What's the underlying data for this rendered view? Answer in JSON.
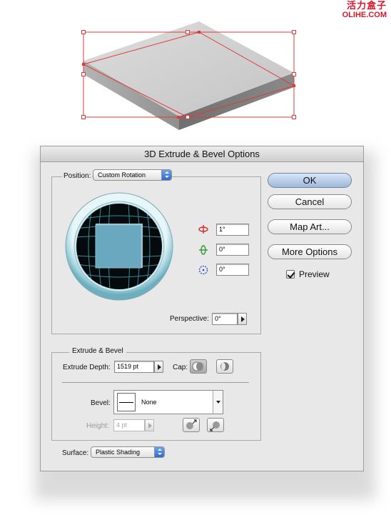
{
  "watermark": {
    "chinese": "活力盒子",
    "latin": "OLIHE.COM"
  },
  "dialog": {
    "title": "3D Extrude & Bevel Options",
    "position": {
      "label": "Position:",
      "value": "Custom Rotation"
    },
    "rotation": {
      "x": "1°",
      "y": "0°",
      "z": "0°"
    },
    "perspective": {
      "label": "Perspective:",
      "value": "0°"
    },
    "extrude_group": {
      "title": "Extrude & Bevel"
    },
    "extrude_depth": {
      "label": "Extrude Depth:",
      "value": "1519 pt"
    },
    "cap": {
      "label": "Cap:"
    },
    "bevel": {
      "label": "Bevel:",
      "value": "None"
    },
    "height": {
      "label": "Height:",
      "value": "4 pt"
    },
    "surface": {
      "label": "Surface:",
      "value": "Plastic Shading"
    },
    "buttons": {
      "ok": "OK",
      "cancel": "Cancel",
      "map_art": "Map Art...",
      "more_options": "More Options"
    },
    "preview": {
      "label": "Preview",
      "checked": true
    }
  },
  "colors": {
    "selection": "#e03a3a",
    "cube_face": "#6aa8bf",
    "track_ring": "#bfe3ea",
    "watermark": "#d8162a",
    "ok_button": "#a9c0de"
  },
  "icons": [
    "rotate-x-icon",
    "rotate-y-icon",
    "rotate-z-icon",
    "cap-on-icon",
    "cap-off-icon",
    "bevel-out-icon",
    "bevel-in-icon",
    "checkbox-checked-icon"
  ]
}
